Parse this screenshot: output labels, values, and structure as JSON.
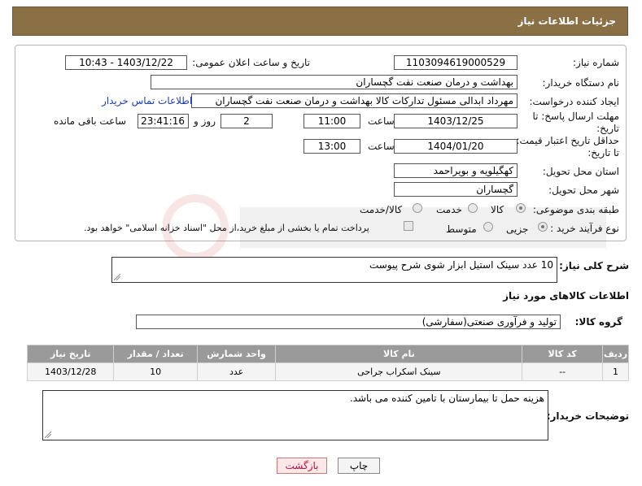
{
  "header": {
    "title": "جزئیات اطلاعات نیاز"
  },
  "form": {
    "need_number": {
      "label": "شماره نیاز:",
      "value": "1103094619000529"
    },
    "announce_datetime": {
      "label": "تاریخ و ساعت اعلان عمومی:",
      "value": "1403/12/22 - 10:43"
    },
    "buyer_org": {
      "label": "نام دستگاه خریدار:",
      "value": "بهداشت و درمان صنعت نفت گچساران"
    },
    "creator": {
      "label": "ایجاد کننده درخواست:",
      "value": "مهرداد ابدالی مسئول تدارکات کالا  بهداشت و درمان صنعت نفت گچساران",
      "contact_link": "اطلاعات تماس خریدار"
    },
    "deadline": {
      "label": "مهلت ارسال پاسخ: تا تاریخ:",
      "date": "1403/12/25",
      "time_label": "ساعت",
      "time": "11:00",
      "days": "2",
      "days_label": "روز و",
      "remaining": "23:41:16",
      "remaining_label": "ساعت باقی مانده"
    },
    "price_validity": {
      "label": "حداقل تاریخ اعتبار قیمت: تا تاریخ:",
      "date": "1404/01/20",
      "time_label": "ساعت",
      "time": "13:00"
    },
    "province": {
      "label": "استان محل تحویل:",
      "value": "کهگیلویه و بویراحمد"
    },
    "city": {
      "label": "شهر محل تحویل:",
      "value": "گچساران"
    },
    "category": {
      "label": "طبقه بندی موضوعی:",
      "options": [
        "کالا",
        "خدمت",
        "کالا/خدمت"
      ],
      "selected": "کالا"
    },
    "purchase_type": {
      "label": "نوع فرآیند خرید :",
      "options": [
        "جزیی",
        "متوسط"
      ],
      "selected": "جزیی",
      "checkbox_text": "پرداخت تمام یا بخشی از مبلغ خرید،از محل \"اسناد خزانه اسلامی\" خواهد بود."
    }
  },
  "description": {
    "label": "شرح کلی نیاز:",
    "value": "10 عدد سینک استیل ابزار شوی شرح پیوست"
  },
  "goods_section": {
    "title": "اطلاعات کالاهای مورد نیاز"
  },
  "goods_group": {
    "label": "گروه کالا:",
    "value": "تولید و فرآوری صنعتی(سفارشی)"
  },
  "table": {
    "headers": [
      "ردیف",
      "کد کالا",
      "نام کالا",
      "واحد شمارش",
      "تعداد / مقدار",
      "تاریخ نیاز"
    ],
    "rows": [
      [
        "1",
        "--",
        "سینک اسکراب جراحی",
        "عدد",
        "10",
        "1403/12/28"
      ]
    ]
  },
  "buyer_notes": {
    "label": "توضیحات خریدار:",
    "value": "هزینه حمل تا بیمارستان با تامین کننده می باشد."
  },
  "buttons": {
    "print": "چاپ",
    "back": "بازگشت"
  },
  "colors": {
    "header": "#8b7046",
    "table_header": "#9a9a9a",
    "link": "#1a3fb5"
  }
}
